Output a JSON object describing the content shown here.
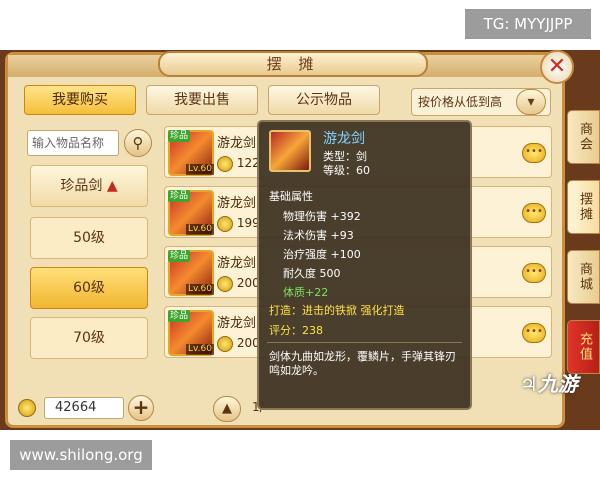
{
  "watermarks": {
    "top": "TG: MYYJJPP",
    "bottom": "www.shilong.org",
    "logo": "九游"
  },
  "header": {
    "title": "摆  摊",
    "close": "✕"
  },
  "tabs": [
    {
      "label": "我要购买",
      "active": true
    },
    {
      "label": "我要出售",
      "active": false
    },
    {
      "label": "公示物品",
      "active": false
    }
  ],
  "sort": {
    "label": "按价格从低到高",
    "icon": "chevron-down-icon"
  },
  "search": {
    "placeholder": "输入物品名称"
  },
  "categories": {
    "header": "珍品剑",
    "items": [
      "50级",
      "60级",
      "70级"
    ],
    "selected": "60级"
  },
  "money": {
    "value": "42664"
  },
  "items": [
    {
      "name": "游龙剑",
      "price": "122",
      "badge": "珍品",
      "level": "Lv.60"
    },
    {
      "name": "游龙剑",
      "price": "199",
      "badge": "珍品",
      "level": "Lv.60"
    },
    {
      "name": "游龙剑",
      "price": "200",
      "badge": "珍品",
      "level": "Lv.60"
    },
    {
      "name": "游龙剑",
      "price": "200",
      "badge": "珍品",
      "level": "Lv.60"
    }
  ],
  "pager": {
    "text": "1/"
  },
  "side_tabs": [
    "商会",
    "摆摊",
    "商城",
    "充值"
  ],
  "tooltip": {
    "name": "游龙剑",
    "type": "类型：剑",
    "level": "等级：60",
    "section": "基础属性",
    "stats": [
      "物理伤害 +392",
      "法术伤害 +93",
      "治疗强度 +100",
      "耐久度 500"
    ],
    "bonus": "体质+22",
    "forge": "打造：进击的铁掀   强化打造",
    "score": "评分：238",
    "desc": "剑体九曲如龙形，覆鳞片，手弹其锋刃鸣如龙吟。"
  }
}
